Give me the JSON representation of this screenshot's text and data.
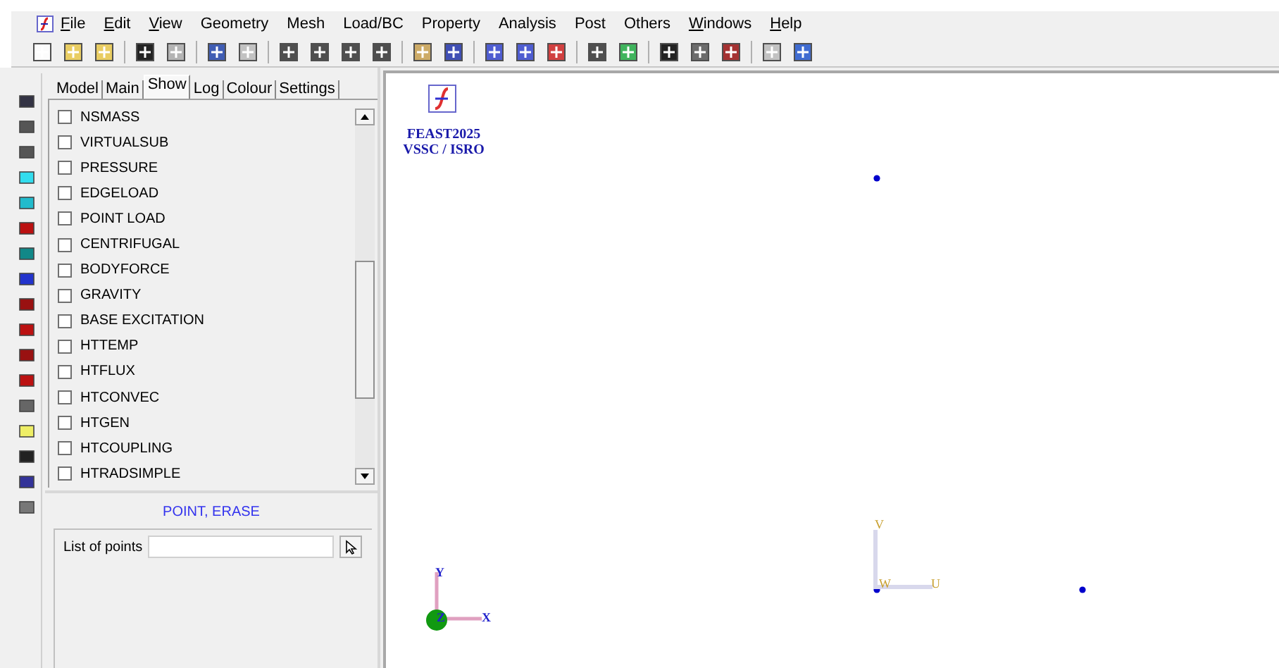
{
  "menu_bar": {
    "items": [
      {
        "label": "File",
        "underlined": true
      },
      {
        "label": "Edit",
        "underlined": true
      },
      {
        "label": "View",
        "underlined": true
      },
      {
        "label": "Geometry",
        "underlined": false
      },
      {
        "label": "Mesh",
        "underlined": false
      },
      {
        "label": "Load/BC",
        "underlined": false
      },
      {
        "label": "Property",
        "underlined": false
      },
      {
        "label": "Analysis",
        "underlined": false
      },
      {
        "label": "Post",
        "underlined": false
      },
      {
        "label": "Others",
        "underlined": false
      },
      {
        "label": "Windows",
        "underlined": true
      },
      {
        "label": "Help",
        "underlined": true
      }
    ]
  },
  "panel": {
    "tabs": [
      {
        "label": "Model",
        "selected": false
      },
      {
        "label": "Main",
        "selected": false
      },
      {
        "label": "Show",
        "selected": true
      },
      {
        "label": "Log",
        "selected": false
      },
      {
        "label": "Colour",
        "selected": false
      },
      {
        "label": "Settings",
        "selected": false
      }
    ],
    "show_items": [
      {
        "label": "NSMASS",
        "checked": false
      },
      {
        "label": "VIRTUALSUB",
        "checked": false
      },
      {
        "label": "PRESSURE",
        "checked": false
      },
      {
        "label": "EDGELOAD",
        "checked": false
      },
      {
        "label": "POINT LOAD",
        "checked": false
      },
      {
        "label": "CENTRIFUGAL",
        "checked": false
      },
      {
        "label": "BODYFORCE",
        "checked": false
      },
      {
        "label": "GRAVITY",
        "checked": false
      },
      {
        "label": "BASE EXCITATION",
        "checked": false
      },
      {
        "label": "HTTEMP",
        "checked": false
      },
      {
        "label": "HTFLUX",
        "checked": false
      },
      {
        "label": "HTCONVEC",
        "checked": false
      },
      {
        "label": "HTGEN",
        "checked": false
      },
      {
        "label": "HTCOUPLING",
        "checked": false
      },
      {
        "label": "HTRADSIMPLE",
        "checked": false
      }
    ],
    "command": {
      "title": "POINT, ERASE",
      "field_label": "List of points"
    }
  },
  "canvas": {
    "logo_lines": [
      "FEAST2025",
      "VSSC / ISRO"
    ],
    "global_axes": {
      "y": "Y",
      "z": "Z",
      "x": "X"
    },
    "local_axes": {
      "v": "V",
      "w": "W",
      "u": "U"
    }
  }
}
